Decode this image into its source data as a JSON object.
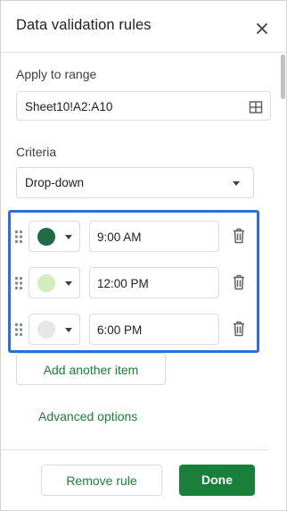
{
  "panel": {
    "title": "Data validation rules"
  },
  "apply_to_range": {
    "label": "Apply to range",
    "value": "Sheet10!A2:A10"
  },
  "criteria": {
    "label": "Criteria",
    "selected": "Drop-down"
  },
  "items": [
    {
      "color": "#1e6b46",
      "value": "9:00 AM"
    },
    {
      "color": "#d4edbc",
      "value": "12:00 PM"
    },
    {
      "color": "#e6e6e6",
      "value": "6:00 PM"
    }
  ],
  "buttons": {
    "add_item": "Add another item",
    "advanced": "Advanced options",
    "remove_rule": "Remove rule",
    "done": "Done"
  },
  "colors": {
    "accent_green": "#188038",
    "highlight_blue": "#2b6fd6"
  },
  "icons": {
    "close": "close-icon",
    "range": "grid-icon",
    "drag": "drag-handle-icon",
    "delete": "trash-icon",
    "dropdown": "chevron-down-icon"
  }
}
